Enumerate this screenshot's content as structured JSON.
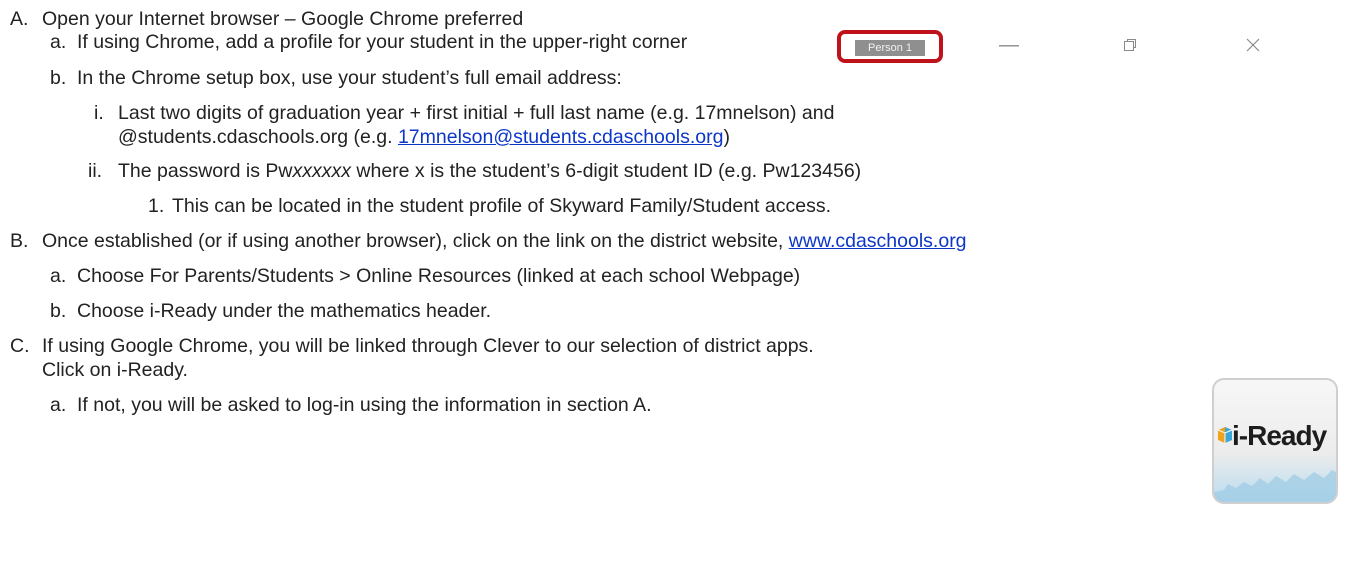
{
  "sectionA": {
    "label": "A.",
    "text": "Open your Internet browser – Google Chrome preferred",
    "a": {
      "label": "a.",
      "text": "If using Chrome, add a profile for your student in the upper-right corner"
    },
    "b": {
      "label": "b.",
      "text": "In the Chrome setup box, use your student’s full email address:",
      "i": {
        "label": "i.",
        "line1": "Last two digits of graduation year + first initial + full last name (e.g. 17mnelson) and",
        "line2_pre": "@students.cdaschools.org (e.g. ",
        "line2_link": "17mnelson@students.cdaschools.org",
        "line2_post": ")"
      },
      "ii": {
        "label": "ii.",
        "pre": "The password is Pw",
        "italic": "xxxxxx",
        "post": " where x is the student’s 6-digit student ID (e.g. Pw123456)",
        "one": {
          "label": "1.",
          "text": "This can be located in the student profile of Skyward Family/Student access."
        }
      }
    }
  },
  "sectionB": {
    "label": "B.",
    "text": "Once established (or if using another browser), click on the link on the district website, ",
    "link": "www.cdaschools.org",
    "a": {
      "label": "a.",
      "text": "Choose For Parents/Students > Online Resources (linked at each school Webpage)"
    },
    "b": {
      "label": "b.",
      "text": "Choose i-Ready under the mathematics header."
    }
  },
  "sectionC": {
    "label": "C.",
    "line1": "If using Google Chrome, you will be linked through Clever to our selection of district apps.",
    "line2": "Click on i-Ready.",
    "a": {
      "label": "a.",
      "text": "If not, you will be asked to log-in using the information in section A."
    }
  },
  "chrome": {
    "profile_label": "Person 1",
    "minimize_icon": "minimize-icon",
    "restore_icon": "restore-icon",
    "close_icon": "close-icon",
    "accent": "#c0121a"
  },
  "iready": {
    "logo_text": "i-Ready"
  }
}
